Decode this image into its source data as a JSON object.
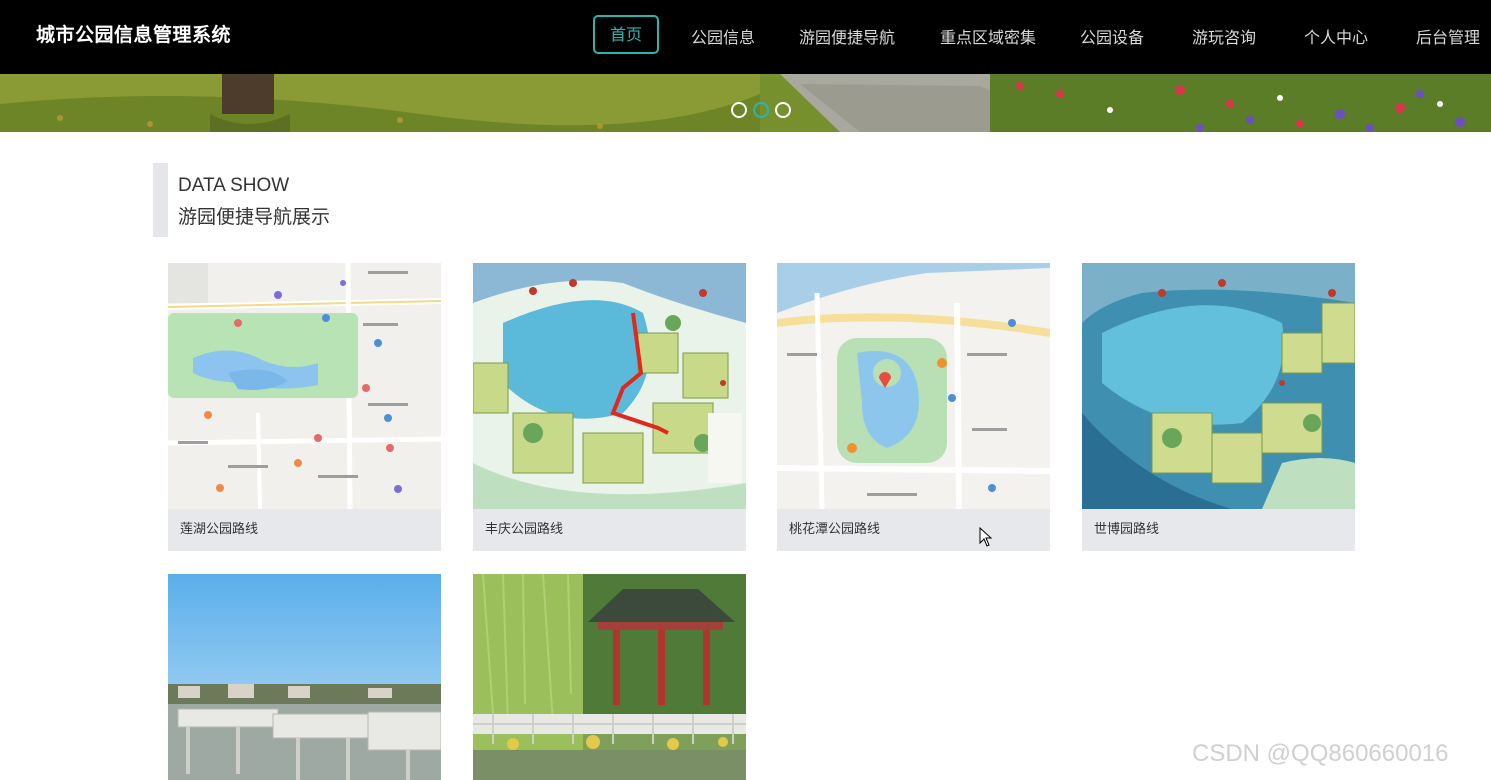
{
  "header": {
    "brand": "城市公园信息管理系统",
    "nav": [
      {
        "label": "首页",
        "active": true
      },
      {
        "label": "公园信息"
      },
      {
        "label": "游园便捷导航"
      },
      {
        "label": "重点区域密集"
      },
      {
        "label": "公园设备"
      },
      {
        "label": "游玩咨询"
      },
      {
        "label": "个人中心"
      },
      {
        "label": "后台管理"
      }
    ],
    "accent_color": "#2bb5b0"
  },
  "banner": {
    "slide_count": 3,
    "active_slide": 2
  },
  "section": {
    "title_en": "DATA SHOW",
    "title_cn": "游园便捷导航展示"
  },
  "cards": [
    {
      "caption": "莲湖公园路线",
      "image": "street-map"
    },
    {
      "caption": "丰庆公园路线",
      "image": "illustrated-park-map-with-route"
    },
    {
      "caption": "桃花潭公园路线",
      "image": "street-map-with-pins"
    },
    {
      "caption": "世博园路线",
      "image": "illustrated-park-map"
    },
    {
      "caption": "",
      "image": "lakeside-bridge-photo"
    },
    {
      "caption": "",
      "image": "pavilion-willow-photo"
    }
  ],
  "watermark": "CSDN @QQ860660016"
}
